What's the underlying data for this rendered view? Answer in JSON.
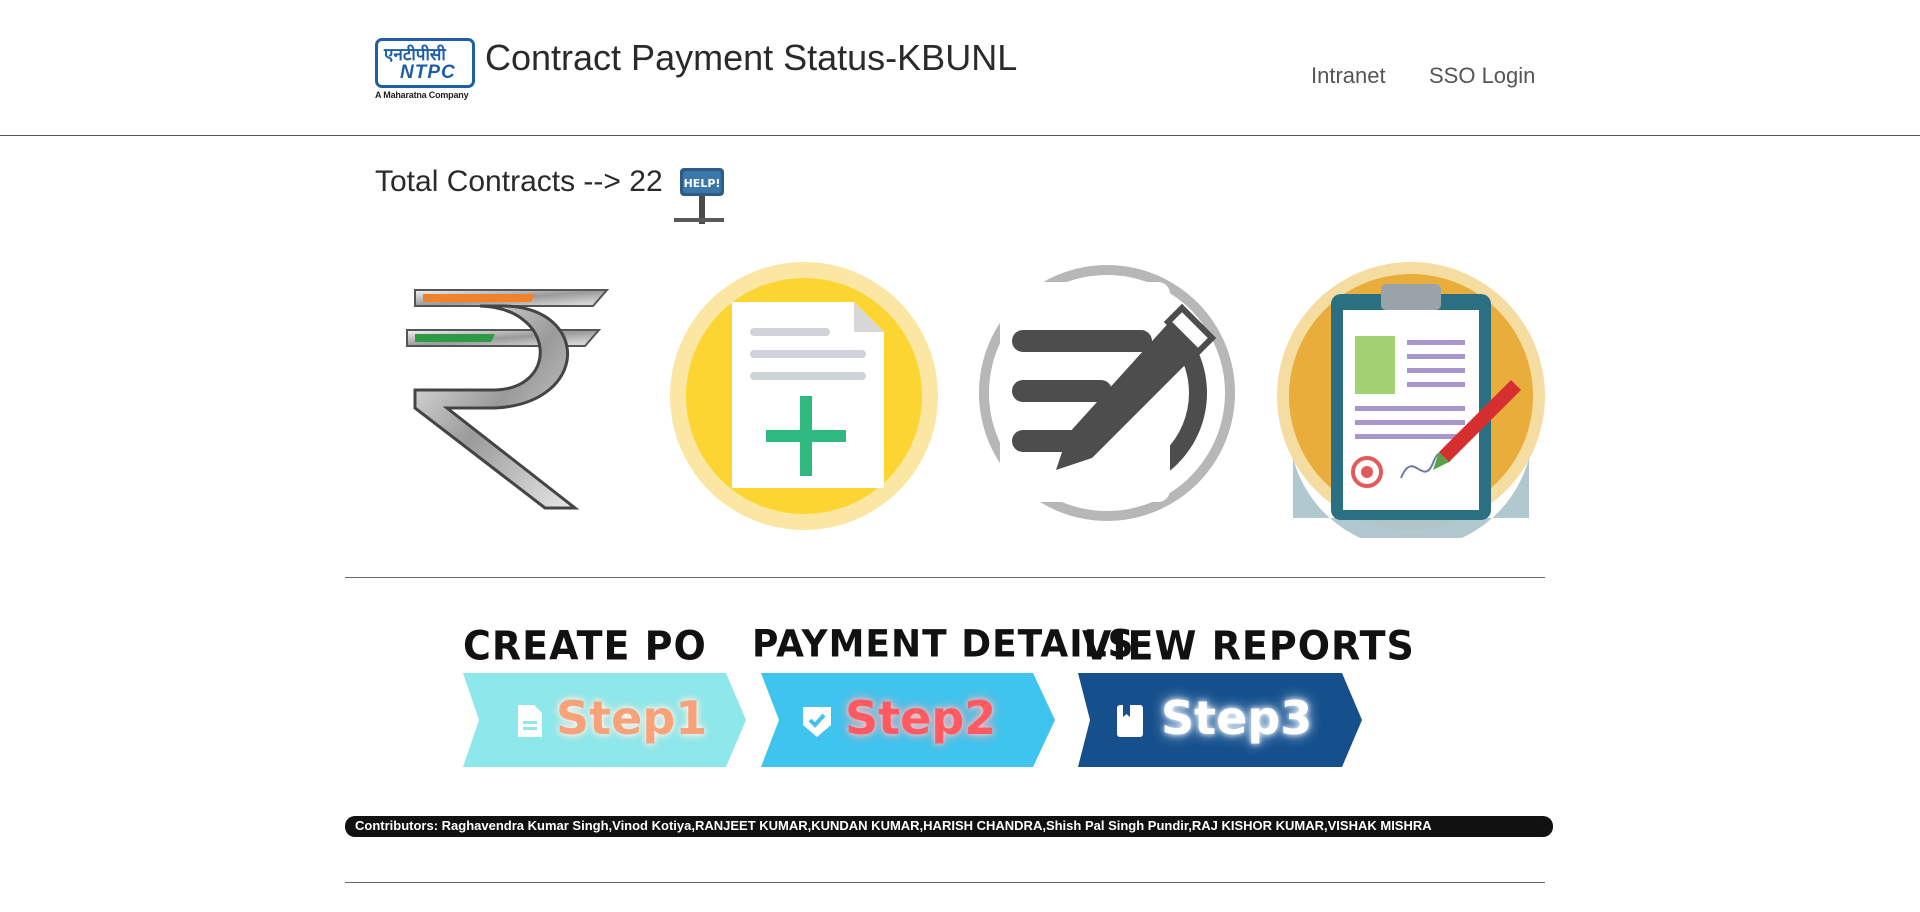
{
  "header": {
    "logo_hindi": "एनटीपीसी",
    "logo_ntpc": "NTPC",
    "logo_tagline": "A Maharatna Company",
    "title": "Contract Payment Status-KBUNL",
    "nav": {
      "intranet": "Intranet",
      "sso_login": "SSO Login"
    }
  },
  "summary": {
    "total_label": "Total Contracts -->",
    "total_value": "22",
    "help_sign_text": "HELP!"
  },
  "features": [
    {
      "name": "rupee-icon"
    },
    {
      "name": "create-document-icon"
    },
    {
      "name": "edit-notes-icon"
    },
    {
      "name": "signed-report-icon"
    }
  ],
  "steps": [
    {
      "title": "CREATE PO",
      "label": "Step1",
      "icon": "file-icon",
      "color": "#8ee7ea"
    },
    {
      "title": "PAYMENT DETAILS",
      "label": "Step2",
      "icon": "check-shield-icon",
      "color": "#3ec4ee"
    },
    {
      "title": "VIEW REPORTS",
      "label": "Step3",
      "icon": "book-icon",
      "color": "#154f8c"
    }
  ],
  "contributors": "Contributors: Raghavendra Kumar Singh,Vinod Kotiya,RANJEET KUMAR,KUNDAN KUMAR,HARISH CHANDRA,Shish Pal Singh Pundir,RAJ KISHOR KUMAR,VISHAK MISHRA"
}
